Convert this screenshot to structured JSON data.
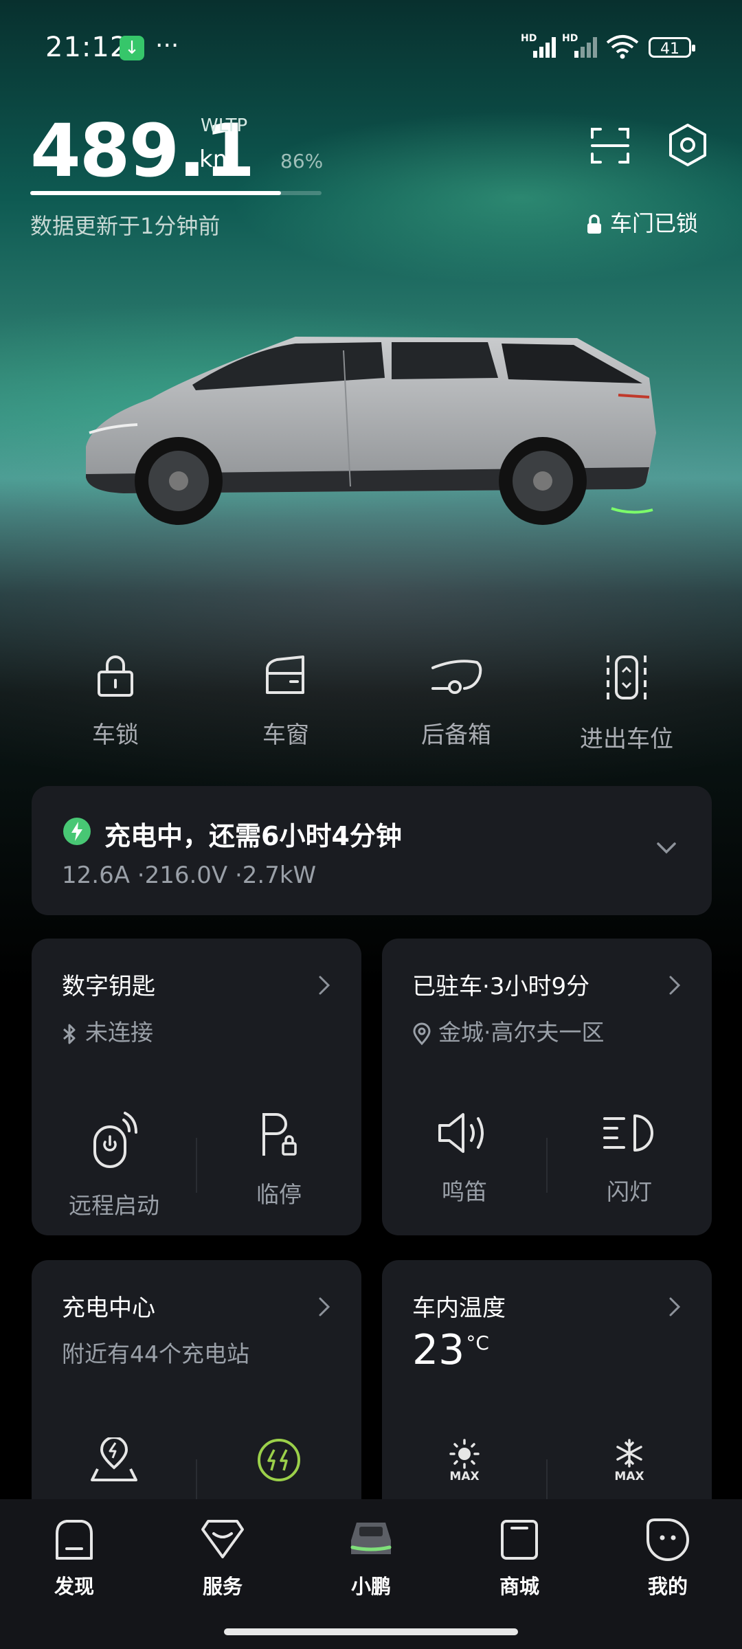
{
  "status_bar": {
    "time": "21:12",
    "battery": "41",
    "network_label": "HD"
  },
  "header": {
    "range_value": "489.1",
    "range_unit": "km",
    "standard": "WLTP",
    "battery_percent": "86%",
    "battery_level": 0.86,
    "updated": "数据更新于1分钟前",
    "lock_status": "车门已锁"
  },
  "quick_actions": [
    {
      "label": "车锁",
      "icon": "lock-icon"
    },
    {
      "label": "车窗",
      "icon": "window-icon"
    },
    {
      "label": "后备箱",
      "icon": "trunk-icon"
    },
    {
      "label": "进出车位",
      "icon": "parking-maneuver-icon"
    }
  ],
  "charging": {
    "title": "充电中，还需6小时4分钟",
    "detail": "12.6A ·216.0V ·2.7kW"
  },
  "cards": {
    "digital_key": {
      "title": "数字钥匙",
      "status": "未连接",
      "actions": [
        "远程启动",
        "临停"
      ]
    },
    "parked": {
      "title": "已驻车·3小时9分",
      "location": "金城·高尔夫一区",
      "actions": [
        "鸣笛",
        "闪灯"
      ]
    },
    "charging_center": {
      "title": "充电中心",
      "subtitle": "附近有44个充电站"
    },
    "cabin_temp": {
      "title": "车内温度",
      "value": "23",
      "unit": "°C",
      "actions": [
        "MAX",
        "MAX"
      ]
    }
  },
  "tabs": [
    {
      "label": "发现",
      "active": false
    },
    {
      "label": "服务",
      "active": false
    },
    {
      "label": "小鹏",
      "active": true
    },
    {
      "label": "商城",
      "active": false
    },
    {
      "label": "我的",
      "active": false
    }
  ],
  "colors": {
    "accent_green": "#48c774",
    "card_bg": "#1a1c21",
    "tab_active_glow": "#7fe07a"
  }
}
